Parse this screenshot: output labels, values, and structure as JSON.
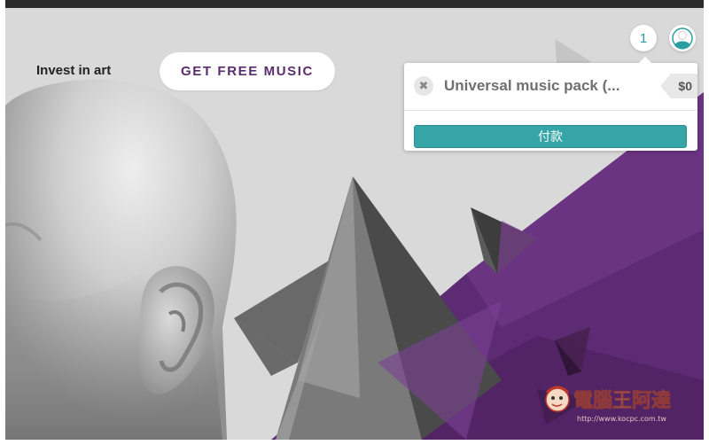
{
  "hero": {
    "tagline": "Invest in art",
    "cta_label": "GET FREE MUSIC"
  },
  "header": {
    "cart_count": "1"
  },
  "cart_popup": {
    "item_name": "Universal music pack (...",
    "price": "$0",
    "remove_icon": "✖",
    "pay_label": "付款"
  },
  "watermark": {
    "text": "電腦王阿達",
    "url": "http://www.kocpc.com.tw"
  },
  "colors": {
    "accent": "#35a5a7",
    "purple": "#5c2b73",
    "background": "#d9d9d9"
  }
}
